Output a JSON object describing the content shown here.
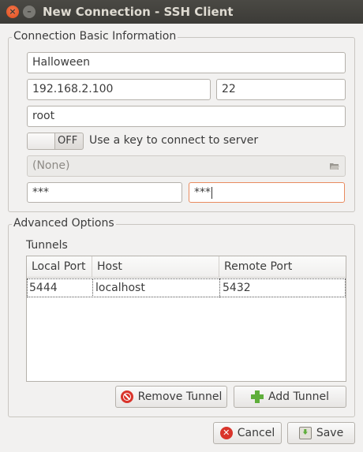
{
  "window": {
    "title": "New Connection - SSH Client",
    "close_glyph": "×",
    "minimize_glyph": "–"
  },
  "basic": {
    "title": "Connection Basic Information",
    "name": "Halloween",
    "host": "192.168.2.100",
    "port": "22",
    "username": "root",
    "use_key_toggle": {
      "state": "OFF",
      "label": "Use a key to connect to server"
    },
    "key_file": "(None)",
    "password": "***",
    "password_confirm": "***"
  },
  "advanced": {
    "title": "Advanced Options",
    "tunnels_label": "Tunnels",
    "columns": [
      "Local Port",
      "Host",
      "Remote Port"
    ],
    "rows": [
      {
        "local_port": "5444",
        "host": "localhost",
        "remote_port": "5432"
      }
    ],
    "remove_button": "Remove Tunnel",
    "add_button": "Add Tunnel"
  },
  "footer": {
    "cancel": "Cancel",
    "save": "Save"
  },
  "colors": {
    "focus_border": "#e98b5f",
    "close_button": "#de4c1b",
    "add_icon": "#5fae3b",
    "remove_icon": "#d9342b"
  }
}
